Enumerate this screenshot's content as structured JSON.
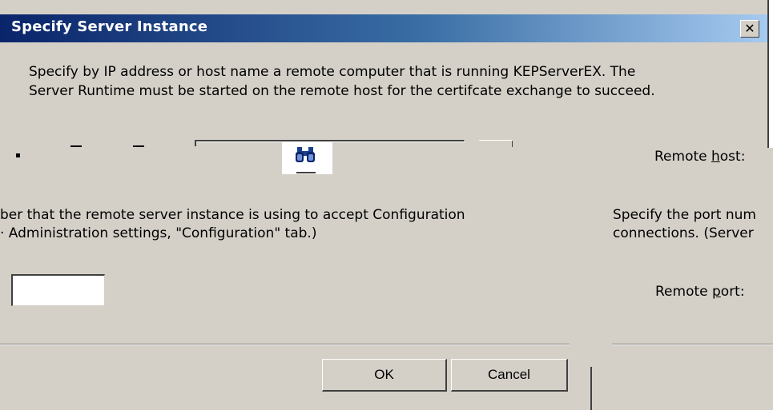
{
  "window": {
    "title": "Specify Server Instance",
    "close_glyph": "✕"
  },
  "intro": {
    "line_1": "Specify by IP address or host name a remote computer that is running KEPServerEX.  The",
    "line_2": "Server Runtime must be started on the remote host for the certifcate exchange to succeed."
  },
  "remote_host": {
    "label_prefix": "Remote ",
    "label_hotkey": "h",
    "label_suffix": "ost:",
    "value": "",
    "browse_icon": "binoculars-icon"
  },
  "port_description": {
    "line_1_left": "ber that the remote server instance is using to accept Configuration",
    "line_2_left": "· Administration settings, \"Configuration\" tab.)",
    "line_1_right": "Specify the port num",
    "line_2_right": "connections.  (Server"
  },
  "remote_port": {
    "label_prefix": "Remote ",
    "label_hotkey": "p",
    "label_suffix": "ort:",
    "value": ""
  },
  "buttons": {
    "ok_label": "OK",
    "cancel_label": "Cancel"
  },
  "colors": {
    "dialog_bg": "#d4d0c8",
    "title_gradient_start": "#0a246a",
    "title_gradient_end": "#a6caf0",
    "title_text": "#ffffff"
  }
}
